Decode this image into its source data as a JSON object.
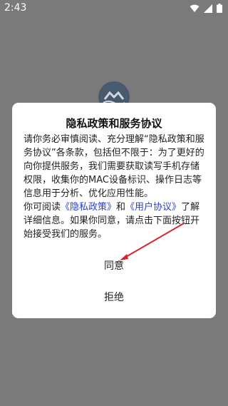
{
  "status_bar": {
    "time": "2:43",
    "icons": [
      "wifi-icon",
      "signal-icon",
      "battery-icon"
    ]
  },
  "dialog": {
    "title": "隐私政策和服务协议",
    "body_part1": "请你务必审慎阅读、充分理解“隐私政策和服务协议”各条款，包括但不限于：为了更好的向你提供服务，我们需要获取读写手机存储权限，收集你的MAC设备标识、操作日志等信息用于分析、优化应用性能。",
    "body_part2_prefix": "你可阅读",
    "privacy_link": "《隐私政策》",
    "and_text": "和",
    "user_agreement_link": "《用户协议》",
    "body_part2_suffix": "了解详细信息。如果你同意，请点击下面按钮开始接受我们的服务。",
    "agree_label": "同意",
    "reject_label": "拒绝"
  },
  "colors": {
    "scrim": "#7a7a7a",
    "link": "#2a3fd6",
    "annotation_arrow": "#d8232a"
  }
}
